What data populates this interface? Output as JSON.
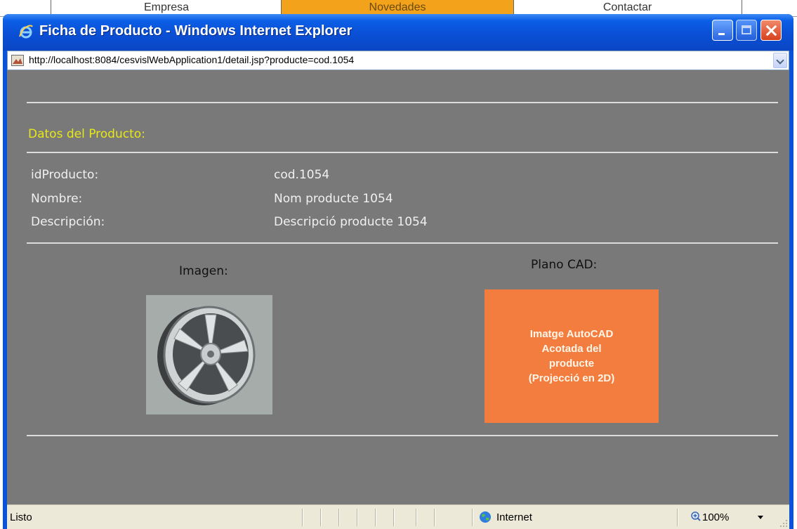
{
  "background_nav": {
    "tabs": [
      "Empresa",
      "Novedades",
      "Contactar"
    ]
  },
  "window": {
    "title": "Ficha de Producto - Windows Internet Explorer",
    "address": "http://localhost:8084/cesvislWebApplication1/detail.jsp?producte=cod.1054"
  },
  "page": {
    "section_title": "Datos del Producto:",
    "fields": [
      {
        "label": "idProducto:",
        "value": "cod.1054"
      },
      {
        "label": "Nombre:",
        "value": "Nom producte 1054"
      },
      {
        "label": "Descripción:",
        "value": "Descripció producte 1054"
      }
    ],
    "image_caption": "Imagen:",
    "cad_caption": "Plano CAD:",
    "cad_placeholder": "Imatge AutoCAD\nAcotada del\nproducte\n(Projecció en 2D)"
  },
  "status": {
    "text": "Listo",
    "zone": "Internet",
    "zoom": "100%"
  },
  "colors": {
    "content_bg": "#797979",
    "section_title": "#e8e817",
    "cad_box": "#f37c3f",
    "titlebar": "#0a4fd5"
  },
  "icons": {
    "title": "ie-logo-icon",
    "address": "page-icon",
    "zone": "globe-icon",
    "zoom": "zoom-icon"
  }
}
